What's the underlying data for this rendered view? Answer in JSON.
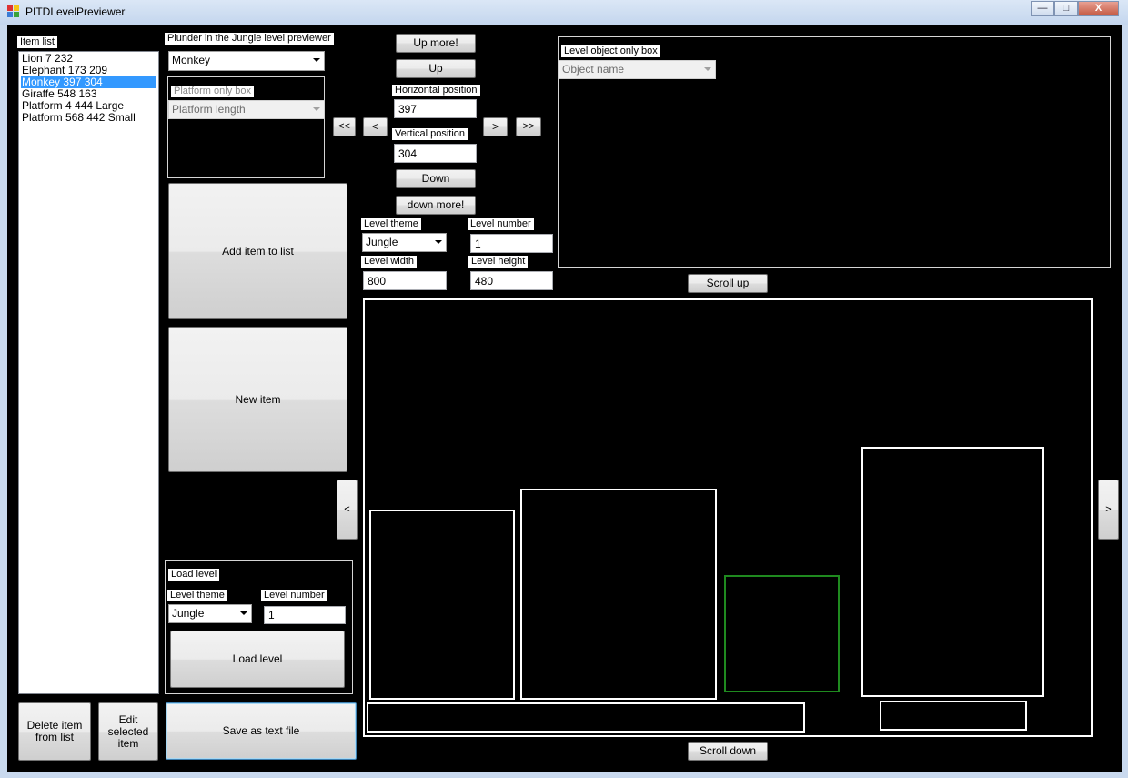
{
  "window": {
    "title": "PITDLevelPreviewer",
    "minimize_glyph": "—",
    "maximize_glyph": "□",
    "close_glyph": "X"
  },
  "item_list": {
    "label": "Item list",
    "items": [
      {
        "text": "Lion 7 232",
        "selected": false
      },
      {
        "text": "Elephant 173 209",
        "selected": false
      },
      {
        "text": "Monkey 397 304",
        "selected": true
      },
      {
        "text": "Giraffe 548 163",
        "selected": false
      },
      {
        "text": "Platform 4 444 Large",
        "selected": false
      },
      {
        "text": "Platform 568 442 Small",
        "selected": false
      }
    ]
  },
  "bottom_buttons": {
    "delete": "Delete item from list",
    "edit": "Edit selected item",
    "save": "Save as text file"
  },
  "previewer": {
    "label": "Plunder in the Jungle level previewer",
    "object_combo": "Monkey",
    "platform_box_label": "Platform only box",
    "platform_length": "Platform length",
    "add_item": "Add item to list",
    "new_item": "New item"
  },
  "position": {
    "up_more": "Up more!",
    "up": "Up",
    "horizontal_label": "Horizontal position",
    "horizontal_value": "397",
    "vertical_label": "Vertical position",
    "vertical_value": "304",
    "down": "Down",
    "down_more": "down more!",
    "left_more": "<<",
    "left": "<",
    "right": ">",
    "right_more": ">>"
  },
  "level_settings": {
    "theme_label": "Level theme",
    "theme_value": "Jungle",
    "number_label": "Level number",
    "number_value": "1",
    "width_label": "Level width",
    "width_value": "800",
    "height_label": "Level height",
    "height_value": "480"
  },
  "level_object_box": {
    "label": "Level object only box",
    "object_name": "Object name"
  },
  "scroll": {
    "up": "Scroll up",
    "down": "Scroll down",
    "left": "<",
    "right": ">"
  },
  "load_level": {
    "label": "Load level",
    "theme_label": "Level theme",
    "theme_value": "Jungle",
    "number_label": "Level number",
    "number_value": "1",
    "button": "Load level"
  },
  "colors": {
    "selection": "#3399ff",
    "canvas_background": "#000000",
    "object_outline": "#ffffff",
    "selected_object_outline": "#1f8a1f"
  }
}
